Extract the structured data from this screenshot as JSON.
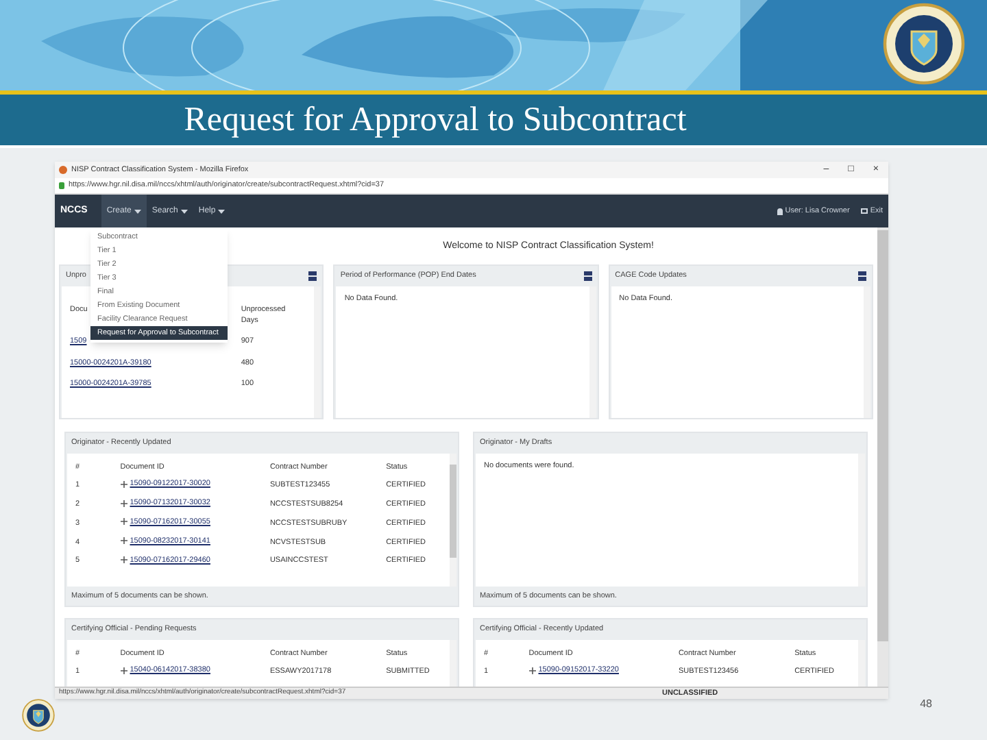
{
  "slide": {
    "title": "Request for Approval to Subcontract",
    "page_number": "48"
  },
  "browser": {
    "title": "NISP Contract Classification System - Mozilla Firefox",
    "controls": [
      "–",
      "□",
      "×"
    ],
    "url": "https://www.hgr.nil.disa.mil/nccs/xhtml/auth/originator/create/subcontractRequest.xhtml?cid=37",
    "status_url": "https://www.hgr.nil.disa.mil/nccs/xhtml/auth/originator/create/subcontractRequest.xhtml?cid=37",
    "classification": "UNCLASSIFIED"
  },
  "navbar": {
    "brand": "NCCS",
    "menus": [
      {
        "label": "Create",
        "expanded": true
      },
      {
        "label": "Search",
        "expanded": false
      },
      {
        "label": "Help",
        "expanded": false
      }
    ],
    "user": "User: Lisa Crowner",
    "exit": "Exit"
  },
  "create_menu": [
    {
      "label": "Subcontract",
      "selected": false
    },
    {
      "label": "Tier 1",
      "selected": false
    },
    {
      "label": "Tier 2",
      "selected": false
    },
    {
      "label": "Tier 3",
      "selected": false
    },
    {
      "label": "Final",
      "selected": false
    },
    {
      "label": "From Existing Document",
      "selected": false
    },
    {
      "label": "Facility Clearance Request",
      "selected": false
    },
    {
      "label": "Request for Approval to Subcontract",
      "selected": true
    }
  ],
  "welcome": "Welcome to NISP Contract Classification System!",
  "top_panels": [
    {
      "title": "Unpro",
      "kind": "table",
      "columns": [
        "Docu",
        "Unprocessed Days"
      ],
      "rows": [
        [
          "1509",
          "907"
        ],
        [
          "15000-0024201A-39180",
          "480"
        ],
        [
          "15000-0024201A-39785",
          "100"
        ]
      ]
    },
    {
      "title": "Period of Performance (POP) End Dates",
      "kind": "empty",
      "message": "No Data Found."
    },
    {
      "title": "CAGE Code Updates",
      "kind": "empty",
      "message": "No Data Found."
    }
  ],
  "middle_panels": [
    {
      "title": "Originator - Recently Updated",
      "kind": "table",
      "columns": [
        "#",
        "Document ID",
        "Contract Number",
        "Status"
      ],
      "rows": [
        [
          "1",
          "15090-09122017-30020",
          "SUBTEST123455",
          "CERTIFIED"
        ],
        [
          "2",
          "15090-07132017-30032",
          "NCCSTESTSUB8254",
          "CERTIFIED"
        ],
        [
          "3",
          "15090-07162017-30055",
          "NCCSTESTSUBRUBY",
          "CERTIFIED"
        ],
        [
          "4",
          "15090-08232017-30141",
          "NCVSTESTSUB",
          "CERTIFIED"
        ],
        [
          "5",
          "15090-07162017-29460",
          "USAINCCSTEST",
          "CERTIFIED"
        ]
      ],
      "footer": "Maximum of 5 documents can be shown."
    },
    {
      "title": "Originator - My Drafts",
      "kind": "empty",
      "message": "No documents were found.",
      "footer": "Maximum of 5 documents can be shown."
    }
  ],
  "bottom_panels": [
    {
      "title": "Certifying Official - Pending Requests",
      "kind": "table",
      "columns": [
        "#",
        "Document ID",
        "Contract Number",
        "Status"
      ],
      "rows": [
        [
          "1",
          "15040-06142017-38380",
          "ESSAWY2017178",
          "SUBMITTED"
        ]
      ]
    },
    {
      "title": "Certifying Official - Recently Updated",
      "kind": "table",
      "columns": [
        "#",
        "Document ID",
        "Contract Number",
        "Status"
      ],
      "rows": [
        [
          "1",
          "15090-09152017-33220",
          "SUBTEST123456",
          "CERTIFIED"
        ]
      ]
    }
  ]
}
